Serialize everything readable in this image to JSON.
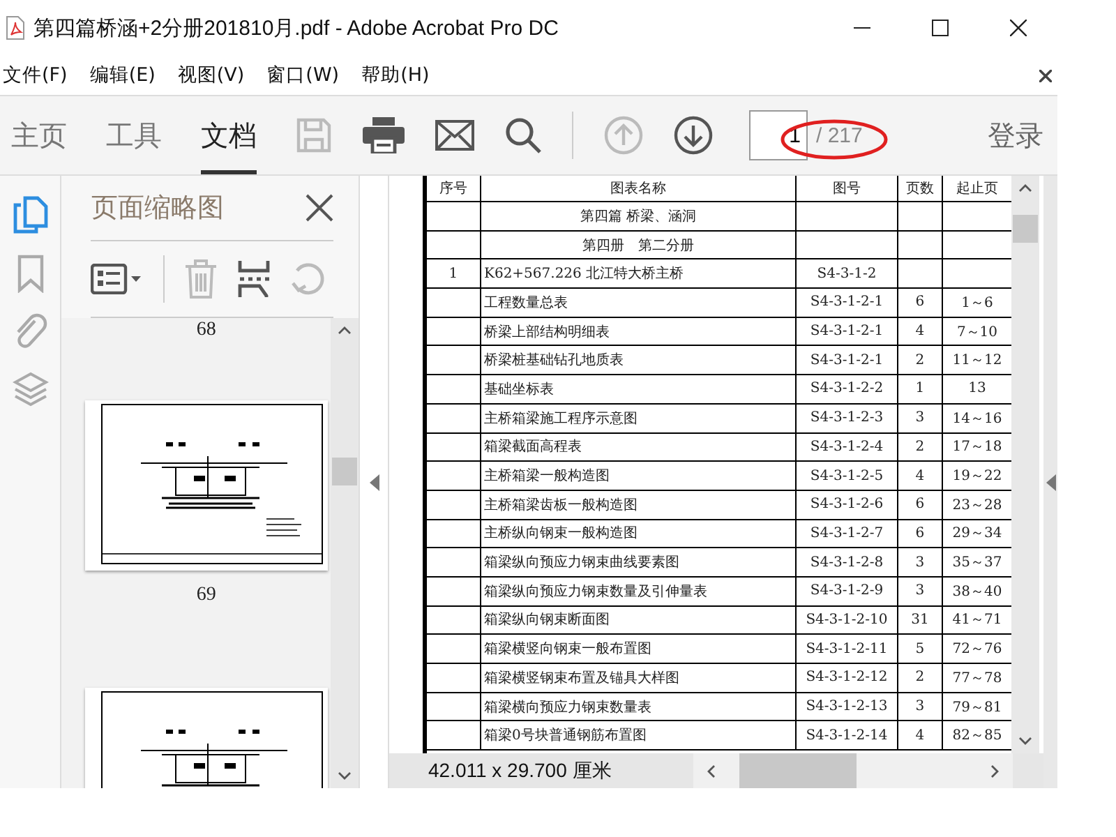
{
  "window": {
    "title": "第四篇桥涵+2分册201810月.pdf - Adobe Acrobat Pro DC"
  },
  "menu": [
    "文件(F)",
    "编辑(E)",
    "视图(V)",
    "窗口(W)",
    "帮助(H)"
  ],
  "toolbar": {
    "tabs": [
      {
        "label": "主页",
        "selected": false
      },
      {
        "label": "工具",
        "selected": false
      },
      {
        "label": "文档",
        "selected": true
      }
    ],
    "tools": [
      {
        "kind": "save",
        "disabled": true
      },
      {
        "kind": "print",
        "disabled": false
      },
      {
        "kind": "mail",
        "disabled": false
      },
      {
        "kind": "search",
        "disabled": false
      },
      {
        "kind": "prev",
        "disabled": true
      },
      {
        "kind": "next",
        "disabled": false
      }
    ],
    "page_input": "1",
    "page_total": "/ 217",
    "sign_in": "登录"
  },
  "side_rail": [
    {
      "kind": "pages",
      "selected": true
    },
    {
      "kind": "bookmark",
      "selected": false
    },
    {
      "kind": "attach",
      "selected": false
    },
    {
      "kind": "layers",
      "selected": false
    }
  ],
  "thumbnail_panel": {
    "title": "页面缩略图",
    "tools": [
      {
        "kind": "options",
        "disabled": false
      },
      {
        "kind": "delete",
        "disabled": true
      },
      {
        "kind": "extract",
        "disabled": false
      },
      {
        "kind": "rotate",
        "disabled": true
      }
    ],
    "pages": [
      {
        "kind": "label",
        "label": "68"
      },
      {
        "kind": "full",
        "label": "69"
      },
      {
        "kind": "image"
      }
    ]
  },
  "table": {
    "columns": [
      "序号",
      "图表名称",
      "图号",
      "页数",
      "起止页"
    ],
    "rows": [
      [
        "",
        "第四篇 桥梁、涵洞",
        "",
        "",
        ""
      ],
      [
        "",
        "第四册　第二分册",
        "",
        "",
        ""
      ],
      [
        "1",
        "K62+567.226 北江特大桥主桥",
        "S4-3-1-2",
        "",
        ""
      ],
      [
        "",
        "工程数量总表",
        "S4-3-1-2-1",
        "6",
        "1～6"
      ],
      [
        "",
        "桥梁上部结构明细表",
        "S4-3-1-2-1",
        "4",
        "7～10"
      ],
      [
        "",
        "桥梁桩基础钻孔地质表",
        "S4-3-1-2-1",
        "2",
        "11～12"
      ],
      [
        "",
        "基础坐标表",
        "S4-3-1-2-2",
        "1",
        "13"
      ],
      [
        "",
        "主桥箱梁施工程序示意图",
        "S4-3-1-2-3",
        "3",
        "14～16"
      ],
      [
        "",
        "箱梁截面高程表",
        "S4-3-1-2-4",
        "2",
        "17～18"
      ],
      [
        "",
        "主桥箱梁一般构造图",
        "S4-3-1-2-5",
        "4",
        "19～22"
      ],
      [
        "",
        "主桥箱梁齿板一般构造图",
        "S4-3-1-2-6",
        "6",
        "23～28"
      ],
      [
        "",
        "主桥纵向钢束一般构造图",
        "S4-3-1-2-7",
        "6",
        "29～34"
      ],
      [
        "",
        "箱梁纵向预应力钢束曲线要素图",
        "S4-3-1-2-8",
        "3",
        "35～37"
      ],
      [
        "",
        "箱梁纵向预应力钢束数量及引伸量表",
        "S4-3-1-2-9",
        "3",
        "38～40"
      ],
      [
        "",
        "箱梁纵向钢束断面图",
        "S4-3-1-2-10",
        "31",
        "41～71"
      ],
      [
        "",
        "箱梁横竖向钢束一般布置图",
        "S4-3-1-2-11",
        "5",
        "72～76"
      ],
      [
        "",
        "箱梁横竖钢束布置及锚具大样图",
        "S4-3-1-2-12",
        "2",
        "77～78"
      ],
      [
        "",
        "箱梁横向预应力钢束数量表",
        "S4-3-1-2-13",
        "3",
        "79～81"
      ],
      [
        "",
        "箱梁0号块普通钢筋布置图",
        "S4-3-1-2-14",
        "4",
        "82～85"
      ]
    ]
  },
  "status_bar": {
    "page_size": "42.011 x 29.700 厘米"
  }
}
